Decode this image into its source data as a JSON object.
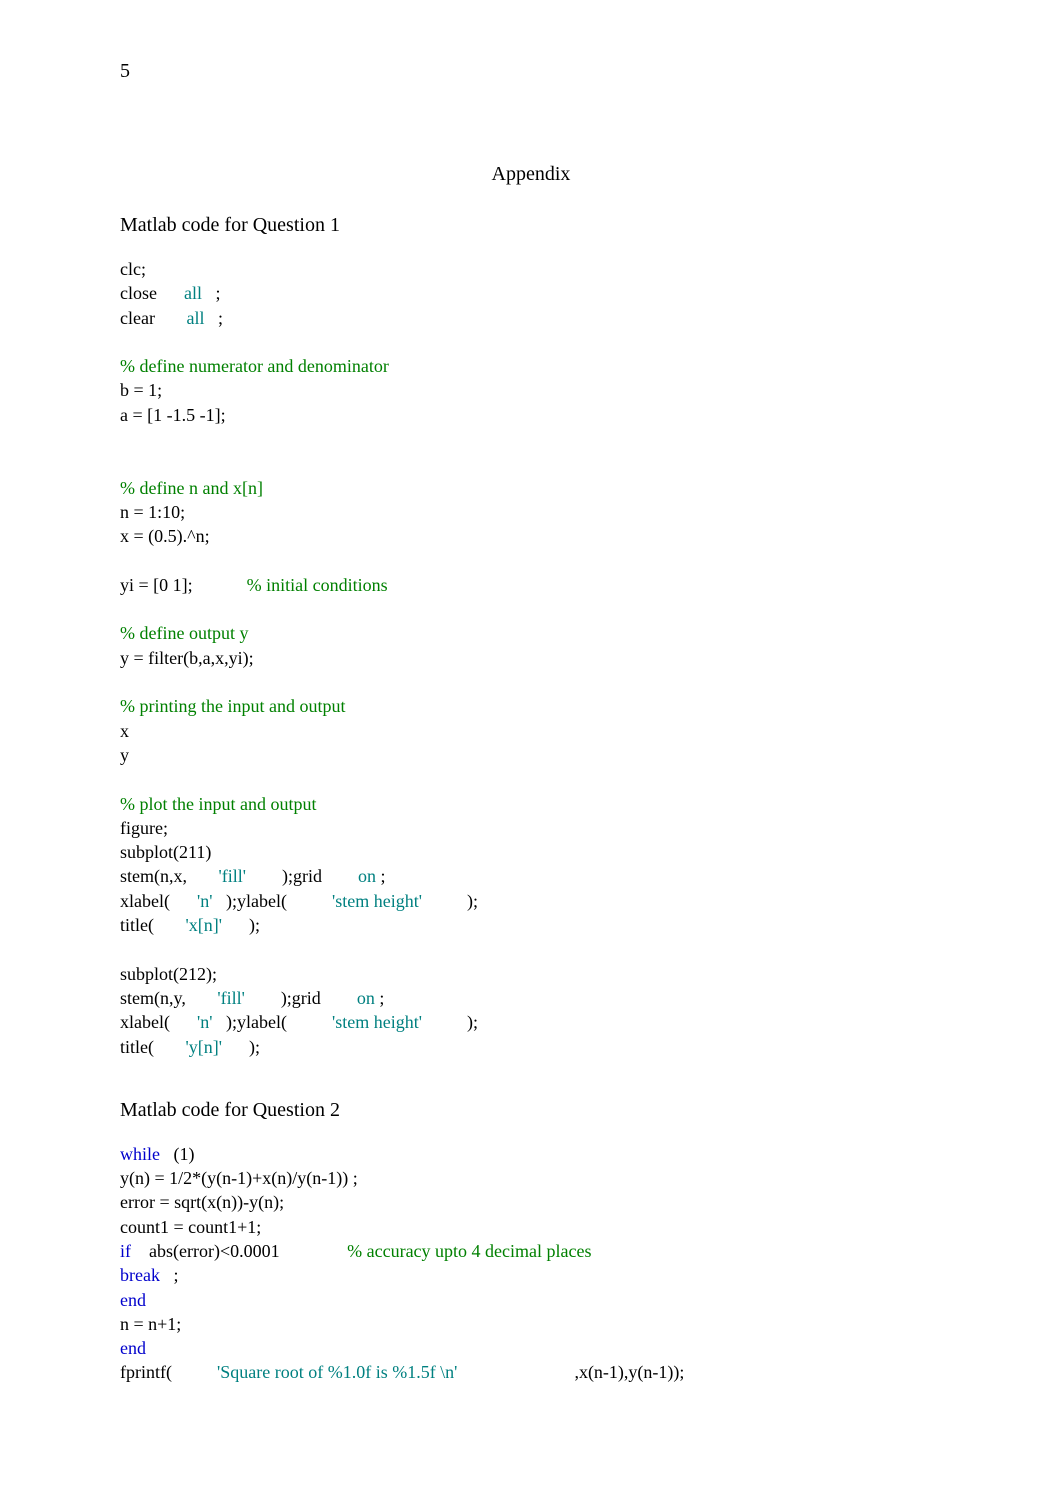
{
  "page_number": "5",
  "appendix": "Appendix",
  "section1_heading_prefix": "Matlab code",
  "section1_heading_rest": "  for Question 1",
  "section2_heading_prefix": "Matlab code",
  "section2_heading_rest": "  for Question 2",
  "code1": {
    "l1": "clc;",
    "l2a": "close      ",
    "l2b": "all",
    "l2c": "   ;",
    "l3a": "clear       ",
    "l3b": "all",
    "l3c": "   ;",
    "l4": "% define numerator and denominator",
    "l5": "b = 1;",
    "l6": "a = [1 -1.5 -1];",
    "l7": "% define n and x[n]",
    "l8": "n = 1:10;",
    "l9": "x = (0.5).^n;",
    "l10a": "yi = [0 1];            ",
    "l10b": "% initial conditions",
    "l11": "% define output y",
    "l12": "y = filter(b,a,x,yi);",
    "l13": "% printing the input and output",
    "l14": "x",
    "l15": "y",
    "l16": "% plot the input and output",
    "l17": "figure;",
    "l18": "subplot(211)",
    "l19a": "stem(n,x,       ",
    "l19b": "'fill'",
    "l19c": "        );grid        ",
    "l19d": "on",
    "l19e": " ;",
    "l20a": "xlabel(      ",
    "l20b": "'n'",
    "l20c": "   );ylabel(          ",
    "l20d": "'stem height'",
    "l20e": "          );",
    "l21a": "title(       ",
    "l21b": "'x[n]'",
    "l21c": "      );",
    "l22": "subplot(212);",
    "l23a": "stem(n,y,       ",
    "l23b": "'fill'",
    "l23c": "        );grid        ",
    "l23d": "on",
    "l23e": " ;",
    "l24a": "xlabel(      ",
    "l24b": "'n'",
    "l24c": "   );ylabel(          ",
    "l24d": "'stem height'",
    "l24e": "          );",
    "l25a": "title(       ",
    "l25b": "'y[n]'",
    "l25c": "      );"
  },
  "code2": {
    "l1a": "while",
    "l1b": "   (1)",
    "l2": "y(n) = 1/2*(y(n-1)+x(n)/y(n-1)) ;",
    "l3": "error = sqrt(x(n))-y(n);",
    "l4": "count1 = count1+1;",
    "l5a": "if",
    "l5b": "    abs(error)<0.0001               ",
    "l5c": "% accuracy upto 4 decimal places",
    "l6a": "break",
    "l6b": "   ;",
    "l7": "end",
    "l8": "n = n+1;",
    "l9": "end",
    "l10a": "fprintf(          ",
    "l10b": "'Square root of %1.0f is %1.5f \\n'",
    "l10c": "                          ,x(n-1),y(n-1));"
  }
}
